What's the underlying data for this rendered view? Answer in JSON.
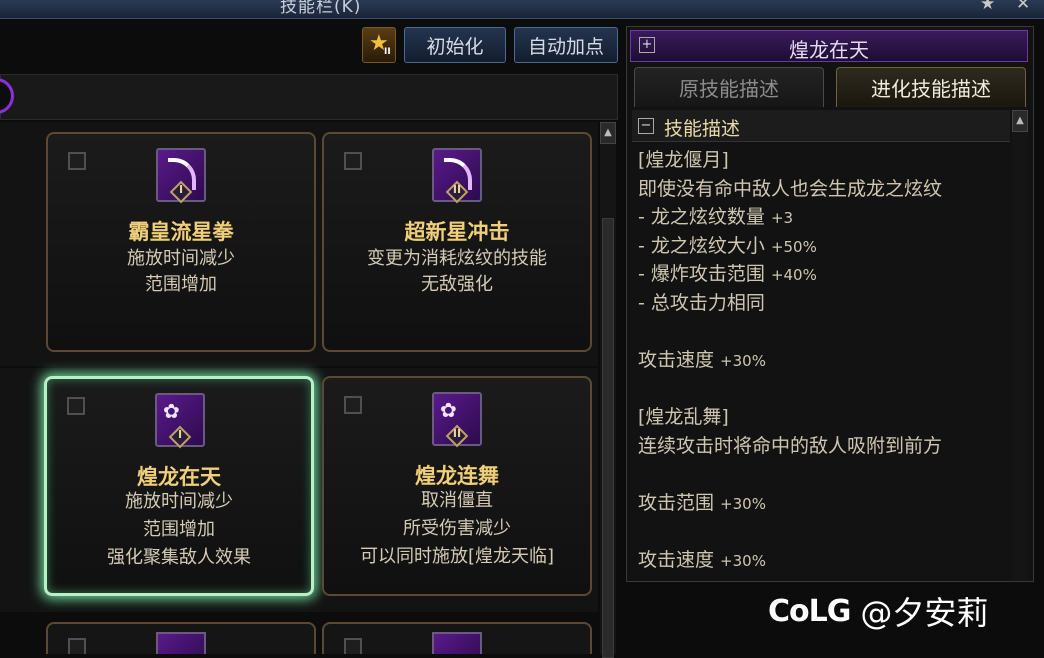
{
  "window": {
    "title": "技能栏(K)",
    "pin_icon": "pin-icon",
    "close_icon": "close-icon"
  },
  "toolbar": {
    "level_icon": "star-level-icon",
    "level_roman": "II",
    "reset_label": "初始化",
    "auto_label": "自动加点"
  },
  "skills": [
    {
      "name": "霸皇流星拳",
      "tier": "I",
      "lines": [
        "施放时间减少",
        "范围增加"
      ],
      "checked": false,
      "selected": false
    },
    {
      "name": "超新星冲击",
      "tier": "II",
      "lines": [
        "变更为消耗炫纹的技能",
        "无敌强化"
      ],
      "checked": false,
      "selected": false
    },
    {
      "name": "煌龙在天",
      "tier": "I",
      "lines": [
        "施放时间减少",
        "范围增加",
        "强化聚集敌人效果"
      ],
      "checked": false,
      "selected": true
    },
    {
      "name": "煌龙连舞",
      "tier": "II",
      "lines": [
        "取消僵直",
        "所受伤害减少",
        "可以同时施放[煌龙天临]"
      ],
      "checked": false,
      "selected": false
    }
  ],
  "detail": {
    "title": "煌龙在天",
    "tabs": [
      {
        "label": "原技能描述",
        "active": false
      },
      {
        "label": "进化技能描述",
        "active": true
      }
    ],
    "section_title": "技能描述",
    "lines": [
      {
        "text": "[煌龙偃月]",
        "value": ""
      },
      {
        "text": "即使没有命中敌人也会生成龙之炫纹",
        "value": ""
      },
      {
        "text": "- 龙之炫纹数量 ",
        "value": "+3"
      },
      {
        "text": "- 龙之炫纹大小 ",
        "value": "+50%"
      },
      {
        "text": "- 爆炸攻击范围 ",
        "value": "+40%"
      },
      {
        "text": "- 总攻击力相同",
        "value": ""
      },
      {
        "text": "",
        "value": ""
      },
      {
        "text": "攻击速度 ",
        "value": "+30%"
      },
      {
        "text": "",
        "value": ""
      },
      {
        "text": "[煌龙乱舞]",
        "value": ""
      },
      {
        "text": "连续攻击时将命中的敌人吸附到前方",
        "value": ""
      },
      {
        "text": "",
        "value": ""
      },
      {
        "text": "攻击范围 ",
        "value": "+30%"
      },
      {
        "text": "",
        "value": ""
      },
      {
        "text": "攻击速度 ",
        "value": "+30%"
      }
    ]
  },
  "watermark": {
    "logo": "CoLG",
    "handle": "@夕安莉"
  },
  "colors": {
    "accent_purple": "#8c2fd8",
    "gold_text": "#f0cf78",
    "selected_glow": "#6fd49a"
  }
}
